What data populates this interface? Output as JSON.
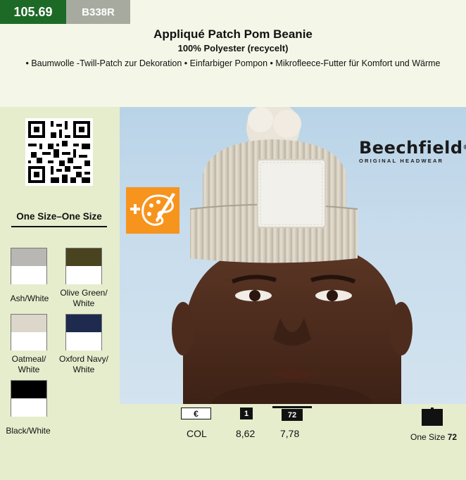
{
  "header": {
    "page_number": "105.69",
    "article_code": "B338R"
  },
  "product": {
    "title": "Appliqué Patch Pom Beanie",
    "material": "100% Polyester (recycelt)",
    "features": "• Baumwolle -Twill-Patch zur Dekoration • Einfarbiger Pompon • Mikrofleece-Futter für Komfort und Wärme"
  },
  "brand": {
    "name": "Beechfield",
    "tagline": "ORIGINAL HEADWEAR",
    "mark": "®"
  },
  "sizes": {
    "heading": "One Size–One Size"
  },
  "colors": [
    {
      "name": "Ash/White",
      "top": "#b8b7b3",
      "bottom": "#ffffff"
    },
    {
      "name": "Olive Green/ White",
      "top": "#4a4320",
      "bottom": "#ffffff"
    },
    {
      "name": "Oatmeal/ White",
      "top": "#dcd6cb",
      "bottom": "#ffffff"
    },
    {
      "name": "Oxford Navy/ White",
      "top": "#1f2a4f",
      "bottom": "#ffffff"
    },
    {
      "name": "Black/White",
      "top": "#000000",
      "bottom": "#ffffff"
    }
  ],
  "pricing": {
    "currency_symbol": "€",
    "qty_1": "1",
    "qty_72": "72",
    "col_label": "COL",
    "price_1": "8,62",
    "price_72": "7,78",
    "carton_label": "One Size",
    "carton_qty": "72"
  },
  "theme": {
    "page_number_bg": "#1d6a27",
    "article_code_bg": "#a7ab9f",
    "panel_bg": "#e6edcd",
    "customize_badge": "#f7941e"
  },
  "icons": [
    "qr-code-icon",
    "palette-brush-icon",
    "euro-icon",
    "carton-icon"
  ]
}
